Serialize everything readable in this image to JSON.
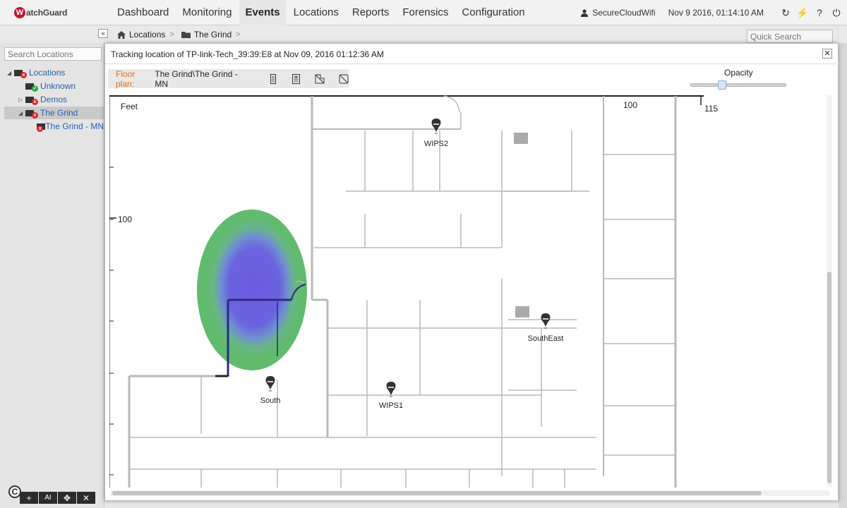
{
  "brand": {
    "logo_letter": "W",
    "logo_text": "atchGuard"
  },
  "nav": {
    "items": [
      {
        "label": "Dashboard"
      },
      {
        "label": "Monitoring"
      },
      {
        "label": "Events"
      },
      {
        "label": "Locations"
      },
      {
        "label": "Reports"
      },
      {
        "label": "Forensics"
      },
      {
        "label": "Configuration"
      }
    ],
    "active": "Events"
  },
  "topright": {
    "user": "SecureCloudWifi",
    "timestamp": "Nov 9 2016, 01:14:10 AM",
    "icons": [
      "refresh-icon",
      "lightning-icon",
      "help-icon",
      "power-icon"
    ],
    "glyphs": {
      "refresh": "↻",
      "lightning": "⚡",
      "help": "?",
      "power": "⏻"
    }
  },
  "breadcrumb": {
    "collapse_glyph": "«",
    "items": [
      {
        "label": "Locations"
      },
      {
        "label": "The Grind"
      }
    ],
    "separator": ">"
  },
  "quick_search": {
    "placeholder": "Quick Search"
  },
  "sidebar": {
    "search_placeholder": "Search Locations",
    "tree": [
      {
        "label": "Locations",
        "status": "error",
        "expanded": true
      },
      {
        "label": "Unknown",
        "status": "ok"
      },
      {
        "label": "Demos",
        "status": "error",
        "expanded": false
      },
      {
        "label": "The Grind",
        "status": "error",
        "expanded": true,
        "selected": true
      },
      {
        "label": "The Grind - MN",
        "status": "error"
      }
    ],
    "toolbar": [
      {
        "label": "+",
        "icon": "plus-icon"
      },
      {
        "label": "AI",
        "icon": "rename-icon"
      },
      {
        "label": "✥",
        "icon": "move-icon"
      },
      {
        "label": "✕",
        "icon": "delete-icon"
      }
    ],
    "copyright_glyph": "C"
  },
  "modal": {
    "title": "Tracking location of TP-link-Tech_39:39:E8 at Nov 09, 2016 01:12:36 AM",
    "close_glyph": "✕",
    "floor_plan_label": "Floor plan:",
    "floor_plan_value": "The Grind\\The Grind - MN",
    "floor_icons": [
      "floor-list-icon",
      "floor-properties-icon",
      "hide-walls-icon",
      "hide-grid-icon"
    ],
    "opacity_label": "Opacity",
    "opacity_value": 0.33
  },
  "floorplan": {
    "unit_label": "Feet",
    "ruler_labels": {
      "top_a": "100",
      "top_b": "115",
      "left": "100"
    },
    "sensors": [
      {
        "name": "WIPS2"
      },
      {
        "name": "SouthEast"
      },
      {
        "name": "WIPS1"
      },
      {
        "name": "South"
      }
    ],
    "colors": {
      "heat_outer": "#61bb6e",
      "heat_inner": "#6a63e0",
      "wall": "#b8b8b8",
      "sensor": "#333333"
    }
  }
}
